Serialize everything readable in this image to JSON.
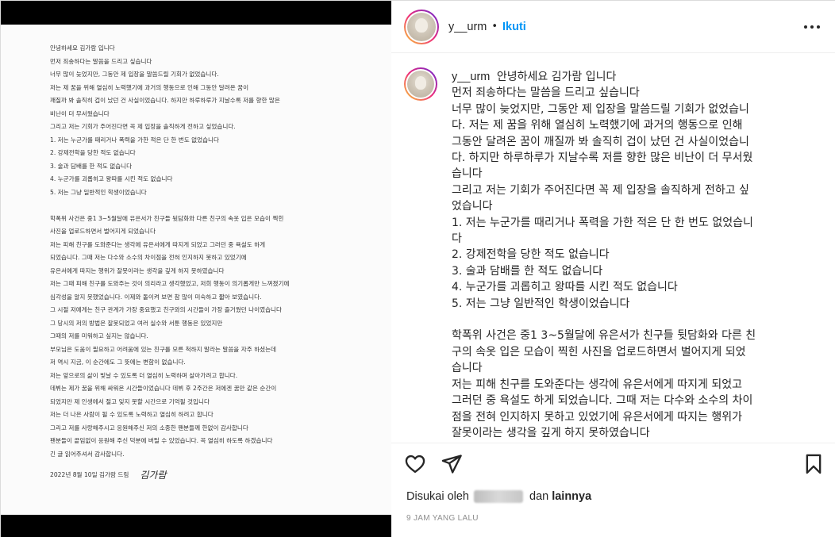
{
  "letter": {
    "lines": [
      "안녕하세요 김가람 입니다",
      "먼저 죄송하다는 말씀을 드리고 싶습니다",
      "너무 많이 늦었지만, 그동안 제 입장을 말씀드릴 기회가 없었습니다.",
      "저는 제 꿈을 위해 열심히 노력했기에 과거의 행동으로 인해 그동안 달려온 꿈이",
      "깨질까 봐 솔직히 겁이 났던 건 사실이었습니다. 하지만 하루하루가 지날수록 저를 향한 많은",
      "비난이 더 무서웠습니다",
      "그리고 저는 기회가 주어진다면 꼭 제 입장을 솔직하게 전하고 싶었습니다.",
      "1.   저는 누군가를 때리거나 폭력을 가한 적은 단 한 번도 없었습니다",
      "2.   강제전학을 당한 적도 없습니다",
      "3.   술과 담배를 한 적도 없습니다",
      "4.   누군가를 괴롭히고 왕따를 시킨 적도 없습니다",
      "5.   저는 그냥 일반적인 학생이었습니다",
      "",
      "학폭위 사건은 중1 3~5월달에 유은서가 친구들 뒷담화와 다른 친구의 속옷 입은 모습이 찍힌",
      "사진을 업로드하면서 벌어지게 되었습니다",
      "저는 피해 친구를 도와준다는 생각에 유은서에게 따지게 되었고 그러던 중 욕설도 하게",
      "되었습니다. 그때 저는 다수와 소수의 차이점을 전혀 인지하지 못하고 있었기에",
      "유은서에게 따지는 행위가 잘못이라는 생각을 깊게 하지 못하였습니다",
      "저는 그때 피해 친구를 도와주는 것이 의리라고 생각했었고, 저희 행동이 의기롭게만 느껴졌기에",
      "심각성을 알지 못했었습니다. 이제와 돌이켜 보면 참 많이 미숙하고 짧아 보였습니다.",
      "그 시절 저에게는 친구 관계가 가장 중요했고 친구와의 시간들이 가장 즐거웠던 나이였습니다",
      "그 당시의 저의 방법은 잘못되었고 여러 실수와 서툰 행동은 있었지만",
      "그때의 저를 미워하고 싶지는 않습니다.",
      "부모님은 도움이 필요하고 어려움에 있는 친구를 모른 척하지 말라는 말씀을 자주 하셨는데",
      "저 역시 지금, 이 순간에도 그 뜻에는 변함이 없습니다.",
      "저는 앞으로의 삶이 빛날 수 있도록 더 열심히 노력하며 살아가려고 합니다.",
      "데뷔는 제가 꿈을 위해 싸워온 시간들이었습니다 데뷔 후 2주간은 저에겐 꿈만 같은 순간이",
      "되었지만 제 인생에서 절고 잊지 못할 시간으로 기억될 것입니다",
      "저는 더 나은 사람이 될 수 있도록 노력하고 열심히 하려고 합니다",
      "그리고 저를 사랑해주시고 응원해주신 저의 소중한 팬분들께 한없이 감사합니다",
      "팬분들이 끝임없이 응원해 주신 덕분에 버틸 수 있었습니다. 꼭 열심히 하도록 하겠습니다",
      "긴 글 읽어주셔서 감사합니다."
    ],
    "signature_date": "2022년 8월 10일 김가람 드림",
    "signature": "김가람"
  },
  "header": {
    "username": "y__urm",
    "dot": "•",
    "follow_label": "Ikuti"
  },
  "caption": {
    "username": "y__urm",
    "first_line": "안녕하세요 김가람 입니다",
    "lines": [
      "먼저 죄송하다는 말씀을 드리고 싶습니다",
      "너무 많이 늦었지만, 그동안 제 입장을 말씀드릴 기회가 없었습니",
      "다. 저는 제 꿈을 위해 열심히 노력했기에 과거의 행동으로 인해",
      "그동안 달려온 꿈이 깨질까 봐 솔직히 겁이 났던 건 사실이었습니",
      "다. 하지만 하루하루가 지날수록 저를 향한 많은 비난이 더 무서웠",
      "습니다",
      "그리고 저는 기회가 주어진다면 꼭 제 입장을 솔직하게 전하고 싶",
      "었습니다",
      "1. 저는 누군가를 때리거나 폭력을 가한 적은 단 한 번도 없었습니",
      "다",
      "2. 강제전학을 당한 적도 없습니다",
      "3. 술과 담배를 한 적도 없습니다",
      "4. 누군가를 괴롭히고 왕따를 시킨 적도 없습니다",
      "5. 저는 그냥 일반적인 학생이었습니다",
      "",
      "학폭위 사건은 중1 3~5월달에 유은서가 친구들 뒷담화와 다른 친",
      "구의 속옷 입은 모습이 찍힌 사진을 업로드하면서 벌어지게 되었",
      "습니다",
      "저는 피해 친구를 도와준다는 생각에 유은서에게 따지게 되었고",
      "그러던 중 욕설도 하게 되었습니다. 그때 저는 다수와 소수의 차이",
      "점을 전혀 인지하지 못하고 있었기에 유은서에게 따지는 행위가",
      "잘못이라는 생각을 깊게 하지 못하였습니다"
    ]
  },
  "actions": {
    "like_icon": "heart-icon",
    "comment_icon": "comment-icon",
    "share_icon": "paper-plane-icon",
    "save_icon": "bookmark-icon"
  },
  "likes": {
    "prefix": "Disukai oleh",
    "connector": "dan",
    "others": "lainnya"
  },
  "timestamp": "9 JAM YANG LALU",
  "colors": {
    "follow_blue": "#0095f6",
    "text": "#262626",
    "muted": "#8e8e8e"
  }
}
